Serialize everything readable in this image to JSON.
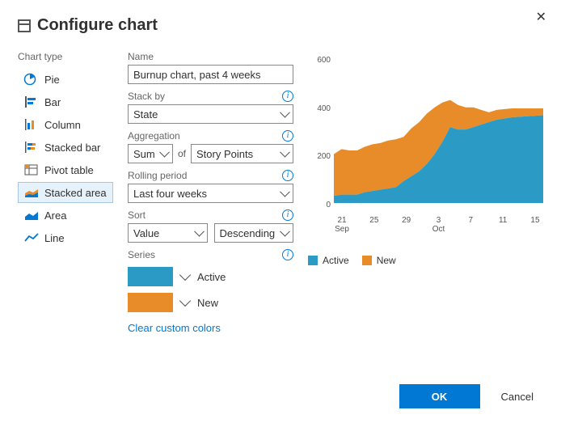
{
  "dialog": {
    "title": "Configure chart",
    "ok": "OK",
    "cancel": "Cancel"
  },
  "sidebar": {
    "heading": "Chart type",
    "types": [
      "Pie",
      "Bar",
      "Column",
      "Stacked bar",
      "Pivot table",
      "Stacked area",
      "Area",
      "Line"
    ],
    "selected_index": 5
  },
  "form": {
    "name_label": "Name",
    "name_value": "Burnup chart, past 4 weeks",
    "stack_label": "Stack by",
    "stack_value": "State",
    "agg_label": "Aggregation",
    "agg_func": "Sum",
    "agg_of": "of",
    "agg_field": "Story Points",
    "rolling_label": "Rolling period",
    "rolling_value": "Last four weeks",
    "sort_label": "Sort",
    "sort_field": "Value",
    "sort_dir": "Descending",
    "series_label": "Series",
    "series": [
      {
        "name": "Active",
        "color": "#2b9bc5"
      },
      {
        "name": "New",
        "color": "#e78c28"
      }
    ],
    "clear_link": "Clear custom colors"
  },
  "chart_data": {
    "type": "area",
    "stacked": true,
    "title": "",
    "xlabel": "",
    "ylabel": "",
    "ylim": [
      0,
      600
    ],
    "yticks": [
      0,
      200,
      400,
      600
    ],
    "x": [
      "21 Sep",
      "22",
      "23",
      "24",
      "25",
      "26",
      "27",
      "28",
      "29",
      "30",
      "1",
      "2",
      "3 Oct",
      "4",
      "5",
      "6",
      "7",
      "8",
      "9",
      "10",
      "11",
      "12",
      "13",
      "14",
      "15",
      "16",
      "17",
      "18"
    ],
    "xticks": [
      {
        "top": "21",
        "bottom": "Sep"
      },
      {
        "top": "25",
        "bottom": ""
      },
      {
        "top": "29",
        "bottom": ""
      },
      {
        "top": "3",
        "bottom": "Oct"
      },
      {
        "top": "7",
        "bottom": ""
      },
      {
        "top": "11",
        "bottom": ""
      },
      {
        "top": "15",
        "bottom": ""
      }
    ],
    "series": [
      {
        "name": "Active",
        "color": "#2b9bc5",
        "values": [
          30,
          35,
          35,
          35,
          45,
          50,
          55,
          60,
          65,
          90,
          110,
          130,
          160,
          200,
          250,
          310,
          300,
          300,
          310,
          320,
          330,
          340,
          345,
          350,
          352,
          354,
          356,
          358
        ]
      },
      {
        "name": "New",
        "color": "#e78c28",
        "values": [
          170,
          185,
          180,
          180,
          185,
          190,
          190,
          195,
          195,
          180,
          195,
          200,
          205,
          190,
          160,
          110,
          100,
          90,
          80,
          60,
          40,
          40,
          38,
          36,
          34,
          32,
          30,
          28
        ]
      }
    ],
    "legend": [
      "Active",
      "New"
    ]
  }
}
